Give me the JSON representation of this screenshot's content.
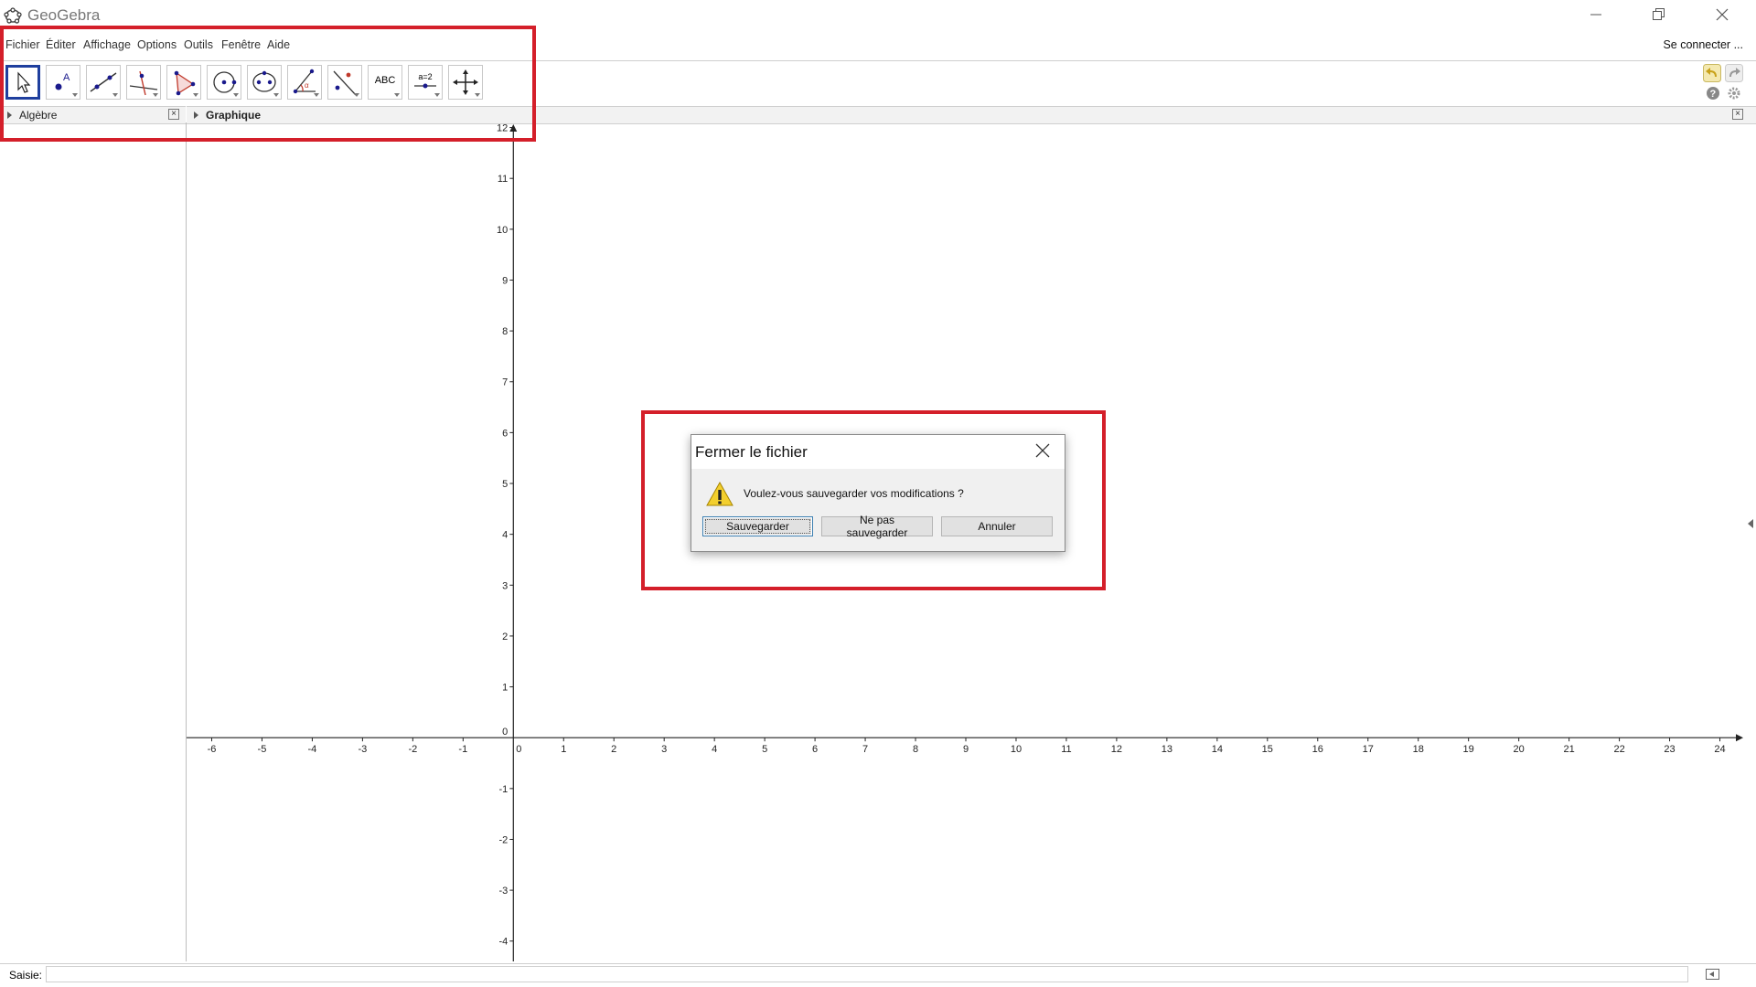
{
  "window": {
    "title": "GeoGebra",
    "minimize_icon": "minimize-icon",
    "maximize_icon": "restore-icon",
    "close_icon": "close-icon"
  },
  "menu": {
    "items": [
      "Fichier",
      "Éditer",
      "Affichage",
      "Options",
      "Outils",
      "Fenêtre",
      "Aide"
    ],
    "login": "Se connecter ..."
  },
  "toolbar": {
    "tools": [
      {
        "icon": "move-pointer-icon",
        "selected": true
      },
      {
        "icon": "point-icon"
      },
      {
        "icon": "line-icon"
      },
      {
        "icon": "perpendicular-line-icon"
      },
      {
        "icon": "polygon-icon"
      },
      {
        "icon": "circle-center-point-icon"
      },
      {
        "icon": "ellipse-icon"
      },
      {
        "icon": "angle-icon"
      },
      {
        "icon": "reflect-icon"
      },
      {
        "icon": "text-icon",
        "label": "ABC"
      },
      {
        "icon": "slider-icon",
        "label": "a=2"
      },
      {
        "icon": "move-graphics-view-icon"
      }
    ],
    "undo_icon": "undo-icon",
    "redo_icon": "redo-icon",
    "help_icon": "help-icon",
    "settings_icon": "settings-gear-icon"
  },
  "views": {
    "algebra_title": "Algèbre",
    "graphics_title": "Graphique"
  },
  "graphics": {
    "x_ticks": [
      "-6",
      "-5",
      "-4",
      "-3",
      "-2",
      "-1",
      "0",
      "1",
      "2",
      "3",
      "4",
      "5",
      "6",
      "7",
      "8",
      "9",
      "10",
      "11",
      "12",
      "13",
      "14",
      "15",
      "16",
      "17",
      "18",
      "19",
      "20",
      "21",
      "22",
      "23",
      "24"
    ],
    "y_ticks": [
      "-4",
      "-3",
      "-2",
      "-1",
      "0",
      "1",
      "2",
      "3",
      "4",
      "5",
      "6",
      "7",
      "8",
      "9",
      "10",
      "11",
      "12"
    ],
    "x_range": [
      -6.5,
      24.5
    ],
    "y_range": [
      -4.4,
      12.1
    ]
  },
  "input_bar": {
    "label": "Saisie:",
    "value": ""
  },
  "dialog": {
    "title": "Fermer le fichier",
    "message": "Voulez-vous sauvegarder vos modifications ?",
    "icon": "warning-icon",
    "buttons": {
      "save": "Sauvegarder",
      "dont_save": "Ne pas sauvegarder",
      "cancel": "Annuler"
    }
  },
  "colors": {
    "highlight": "#d41f2a",
    "selected_tool": "#1f3f9e"
  }
}
